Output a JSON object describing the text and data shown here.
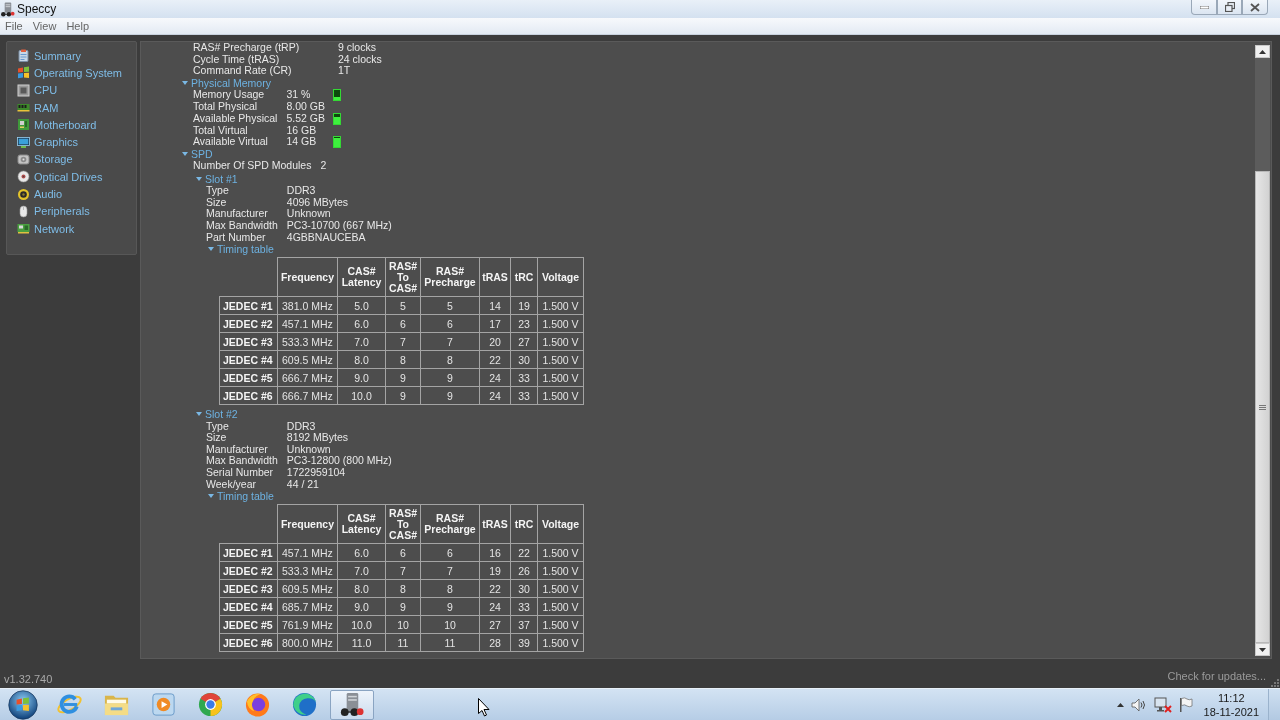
{
  "window": {
    "title": "Speccy"
  },
  "menu": [
    "File",
    "View",
    "Help"
  ],
  "sidebar": {
    "items": [
      "Summary",
      "Operating System",
      "CPU",
      "RAM",
      "Motherboard",
      "Graphics",
      "Storage",
      "Optical Drives",
      "Audio",
      "Peripherals",
      "Network"
    ]
  },
  "content": {
    "rows": [
      {
        "label": "RAS# Precharge (tRP)",
        "value": "9 clocks"
      },
      {
        "label": "Cycle Time (tRAS)",
        "value": "24 clocks"
      },
      {
        "label": "Command Rate (CR)",
        "value": "1T"
      }
    ],
    "sections": [
      {
        "title": "Physical Memory",
        "expanded": true,
        "rows": [
          {
            "label": "Memory Usage",
            "value": "31 %",
            "level": 0.31
          },
          {
            "label": "Total Physical",
            "value": "8.00 GB"
          },
          {
            "label": "Available Physical",
            "value": "5.52 GB",
            "level": 0.69
          },
          {
            "label": "Total Virtual",
            "value": "16 GB"
          },
          {
            "label": "Available Virtual",
            "value": "14 GB",
            "level": 0.88
          }
        ]
      },
      {
        "title": "SPD",
        "expanded": true,
        "rows": [
          {
            "label": "Number Of SPD Modules",
            "value": "2"
          }
        ],
        "slots": [
          {
            "title": "Slot #1",
            "expanded": true,
            "rows": [
              {
                "label": "Type",
                "value": "DDR3"
              },
              {
                "label": "Size",
                "value": "4096 MBytes"
              },
              {
                "label": "Manufacturer",
                "value": "Unknown"
              },
              {
                "label": "Max Bandwidth",
                "value": "PC3-10700 (667 MHz)"
              },
              {
                "label": "Part Number",
                "value": "4GBBNAUCEBA"
              }
            ],
            "timing_table": {
              "title": "Timing table",
              "expanded": true,
              "columns": [
                "Frequency",
                "CAS#\nLatency",
                "RAS#\nTo\nCAS#",
                "RAS#\nPrecharge",
                "tRAS",
                "tRC",
                "Voltage"
              ],
              "rows": [
                {
                  "label": "JEDEC #1",
                  "cells": [
                    "381.0 MHz",
                    "5.0",
                    "5",
                    "5",
                    "14",
                    "19",
                    "1.500 V"
                  ]
                },
                {
                  "label": "JEDEC #2",
                  "cells": [
                    "457.1 MHz",
                    "6.0",
                    "6",
                    "6",
                    "17",
                    "23",
                    "1.500 V"
                  ]
                },
                {
                  "label": "JEDEC #3",
                  "cells": [
                    "533.3 MHz",
                    "7.0",
                    "7",
                    "7",
                    "20",
                    "27",
                    "1.500 V"
                  ]
                },
                {
                  "label": "JEDEC #4",
                  "cells": [
                    "609.5 MHz",
                    "8.0",
                    "8",
                    "8",
                    "22",
                    "30",
                    "1.500 V"
                  ]
                },
                {
                  "label": "JEDEC #5",
                  "cells": [
                    "666.7 MHz",
                    "9.0",
                    "9",
                    "9",
                    "24",
                    "33",
                    "1.500 V"
                  ]
                },
                {
                  "label": "JEDEC #6",
                  "cells": [
                    "666.7 MHz",
                    "10.0",
                    "9",
                    "9",
                    "24",
                    "33",
                    "1.500 V"
                  ]
                }
              ]
            }
          },
          {
            "title": "Slot #2",
            "expanded": true,
            "rows": [
              {
                "label": "Type",
                "value": "DDR3"
              },
              {
                "label": "Size",
                "value": "8192 MBytes"
              },
              {
                "label": "Manufacturer",
                "value": "Unknown"
              },
              {
                "label": "Max Bandwidth",
                "value": "PC3-12800 (800 MHz)"
              },
              {
                "label": "Serial Number",
                "value": "1722959104"
              },
              {
                "label": "Week/year",
                "value": "44 / 21"
              }
            ],
            "timing_table": {
              "title": "Timing table",
              "expanded": true,
              "columns": [
                "Frequency",
                "CAS#\nLatency",
                "RAS#\nTo\nCAS#",
                "RAS#\nPrecharge",
                "tRAS",
                "tRC",
                "Voltage"
              ],
              "rows": [
                {
                  "label": "JEDEC #1",
                  "cells": [
                    "457.1 MHz",
                    "6.0",
                    "6",
                    "6",
                    "16",
                    "22",
                    "1.500 V"
                  ]
                },
                {
                  "label": "JEDEC #2",
                  "cells": [
                    "533.3 MHz",
                    "7.0",
                    "7",
                    "7",
                    "19",
                    "26",
                    "1.500 V"
                  ]
                },
                {
                  "label": "JEDEC #3",
                  "cells": [
                    "609.5 MHz",
                    "8.0",
                    "8",
                    "8",
                    "22",
                    "30",
                    "1.500 V"
                  ]
                },
                {
                  "label": "JEDEC #4",
                  "cells": [
                    "685.7 MHz",
                    "9.0",
                    "9",
                    "9",
                    "24",
                    "33",
                    "1.500 V"
                  ]
                },
                {
                  "label": "JEDEC #5",
                  "cells": [
                    "761.9 MHz",
                    "10.0",
                    "10",
                    "10",
                    "27",
                    "37",
                    "1.500 V"
                  ]
                },
                {
                  "label": "JEDEC #6",
                  "cells": [
                    "800.0 MHz",
                    "11.0",
                    "11",
                    "11",
                    "28",
                    "39",
                    "1.500 V"
                  ]
                }
              ]
            }
          }
        ]
      }
    ]
  },
  "status_bar": {
    "version": "v1.32.740",
    "update_link": "Check for updates..."
  },
  "taskbar": {
    "apps": [
      {
        "selected": false
      },
      {
        "selected": false
      },
      {
        "selected": false
      },
      {
        "selected": false
      },
      {
        "selected": false
      },
      {
        "selected": false
      },
      {
        "selected": true
      }
    ],
    "clock": {
      "time": "11:12",
      "date": "18-11-2021"
    }
  }
}
